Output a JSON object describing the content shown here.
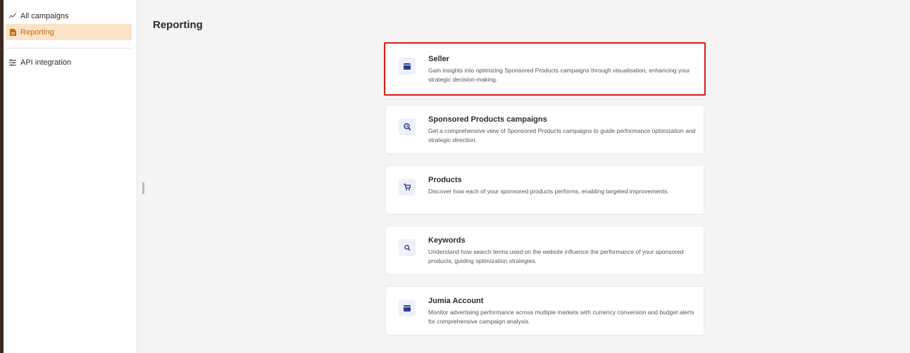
{
  "sidebar": {
    "items": [
      {
        "label": "All campaigns",
        "icon": "trend-line-icon"
      },
      {
        "label": "Reporting",
        "icon": "document-icon"
      },
      {
        "label": "API integration",
        "icon": "list-settings-icon"
      }
    ]
  },
  "main": {
    "title": "Reporting",
    "cards": [
      {
        "title": "Seller",
        "description": "Gain insights into optimizing Sponsored Products campaigns through visualisation, enhancing your strategic decision-making.",
        "icon": "store-icon"
      },
      {
        "title": "Sponsored Products campaigns",
        "description": "Get a comprehensive view of Sponsored Products campaigns to guide performance optimization and strategic direction.",
        "icon": "magnifier-chart-icon"
      },
      {
        "title": "Products",
        "description": "Discover how each of your sponsored products performs, enabling targeted improvements.",
        "icon": "cart-icon"
      },
      {
        "title": "Keywords",
        "description": "Understand how search terms used on the website influence the performance of your sponsored products, guiding optimization strategies.",
        "icon": "search-icon"
      },
      {
        "title": "Jumia Account",
        "description": "Monitor advertising performance across multiple markets with currency conversion and budget alerts for comprehensive campaign analysis.",
        "icon": "store-icon"
      }
    ]
  },
  "colors": {
    "accent": "#c86a0f",
    "active_bg": "#fbe3c8",
    "highlight": "#d81b1b",
    "icon": "#2b3a8f"
  }
}
